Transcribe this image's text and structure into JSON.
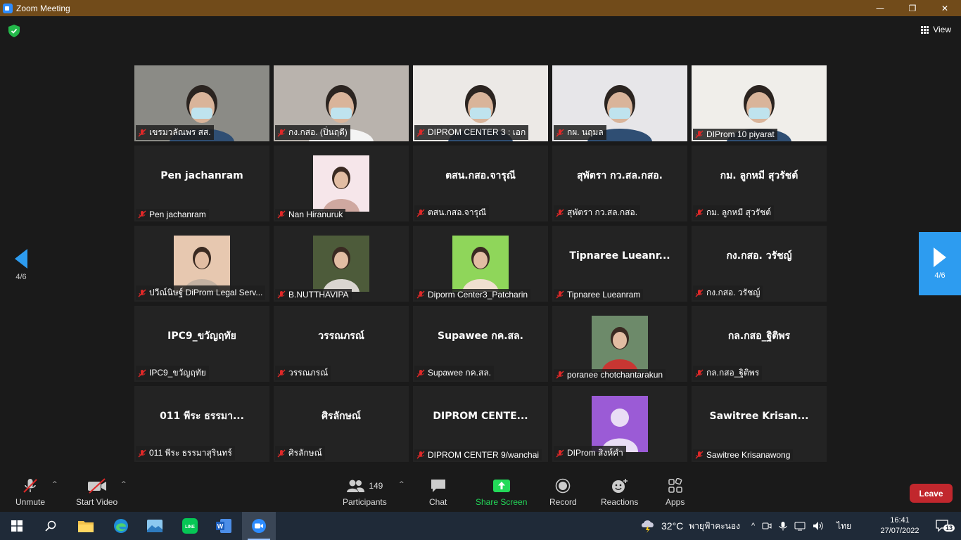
{
  "window": {
    "title": "Zoom Meeting",
    "controls": [
      "—",
      "❐",
      "✕"
    ]
  },
  "header": {
    "view_label": "View"
  },
  "nav": {
    "left_page": "4/6",
    "right_page": "4/6"
  },
  "tiles": [
    {
      "label": "เขรมวลัณพร สส.",
      "type": "video"
    },
    {
      "label": "กง.กสอ. (ปิ่นฤดี)",
      "type": "video"
    },
    {
      "label": "DIPROM CENTER 3 : เอก",
      "type": "video"
    },
    {
      "label": "กผ. นฤมล",
      "type": "video"
    },
    {
      "label": "DIProm 10 piyarat",
      "type": "video"
    },
    {
      "label": "Pen jachanram",
      "center": "Pen jachanram",
      "type": "name"
    },
    {
      "label": "Nan Hiranuruk",
      "type": "photo"
    },
    {
      "label": "ตสน.กสอ.จารุณี",
      "center": "ตสน.กสอ.จารุณี",
      "type": "name"
    },
    {
      "label": "สุพัตรา กว.สล.กสอ.",
      "center": "สุพัตรา กว.สล.กสอ.",
      "type": "name"
    },
    {
      "label": "กม. ลูกหมี สุวรัชต์",
      "center": "กม. ลูกหมี สุวรัชต์",
      "type": "name"
    },
    {
      "label": "ปวีณ์นิษฐ์ DiProm Legal Serv...",
      "type": "photo"
    },
    {
      "label": "B.NUTTHAVIPA",
      "type": "photo"
    },
    {
      "label": "Diporm Center3_Patcharin",
      "type": "photo"
    },
    {
      "label": "Tipnaree Lueanram",
      "center": "Tipnaree Lueanr...",
      "type": "name"
    },
    {
      "label": "กง.กสอ. วรัชญ์",
      "center": "กง.กสอ. วรัชญ์",
      "type": "name"
    },
    {
      "label": "IPC9_ขวัญฤทัย",
      "center": "IPC9_ขวัญฤทัย",
      "type": "name"
    },
    {
      "label": "วรรณภรณ์",
      "center": "วรรณภรณ์",
      "type": "name"
    },
    {
      "label": "Supawee กค.สล.",
      "center": "Supawee กค.สล.",
      "type": "name"
    },
    {
      "label": "poranee chotchantarakun",
      "type": "photo"
    },
    {
      "label": "กล.กสอ_ฐิติพร",
      "center": "กล.กสอ_ฐิติพร",
      "type": "name"
    },
    {
      "label": "011 พีระ ธรรมาสุรินทร์",
      "center": "011 พีระ ธรรมา...",
      "type": "name"
    },
    {
      "label": "ศิรลักษณ์",
      "center": "ศิรลักษณ์",
      "type": "name"
    },
    {
      "label": "DIPROM CENTER 9/wanchai",
      "center": "DIPROM CENTE...",
      "type": "name"
    },
    {
      "label": "DIProm สิงห์คำ",
      "type": "avatar"
    },
    {
      "label": "Sawitree Krisanawong",
      "center": "Sawitree Krisan...",
      "type": "name"
    }
  ],
  "toolbar": {
    "unmute": "Unmute",
    "start_video": "Start Video",
    "participants": "Participants",
    "participants_count": "149",
    "chat": "Chat",
    "share_screen": "Share Screen",
    "record": "Record",
    "reactions": "Reactions",
    "apps": "Apps",
    "leave": "Leave"
  },
  "taskbar": {
    "temperature": "32°C",
    "weather": "พายุฟ้าคะนอง",
    "language": "ไทย",
    "time": "16:41",
    "date": "27/07/2022",
    "notifications": "13"
  },
  "colors": {
    "titlebar": "#714b1a",
    "accent": "#2d9cf0",
    "share_green": "#23d959",
    "leave_red": "#c1272d",
    "mute_red": "#e02828"
  }
}
